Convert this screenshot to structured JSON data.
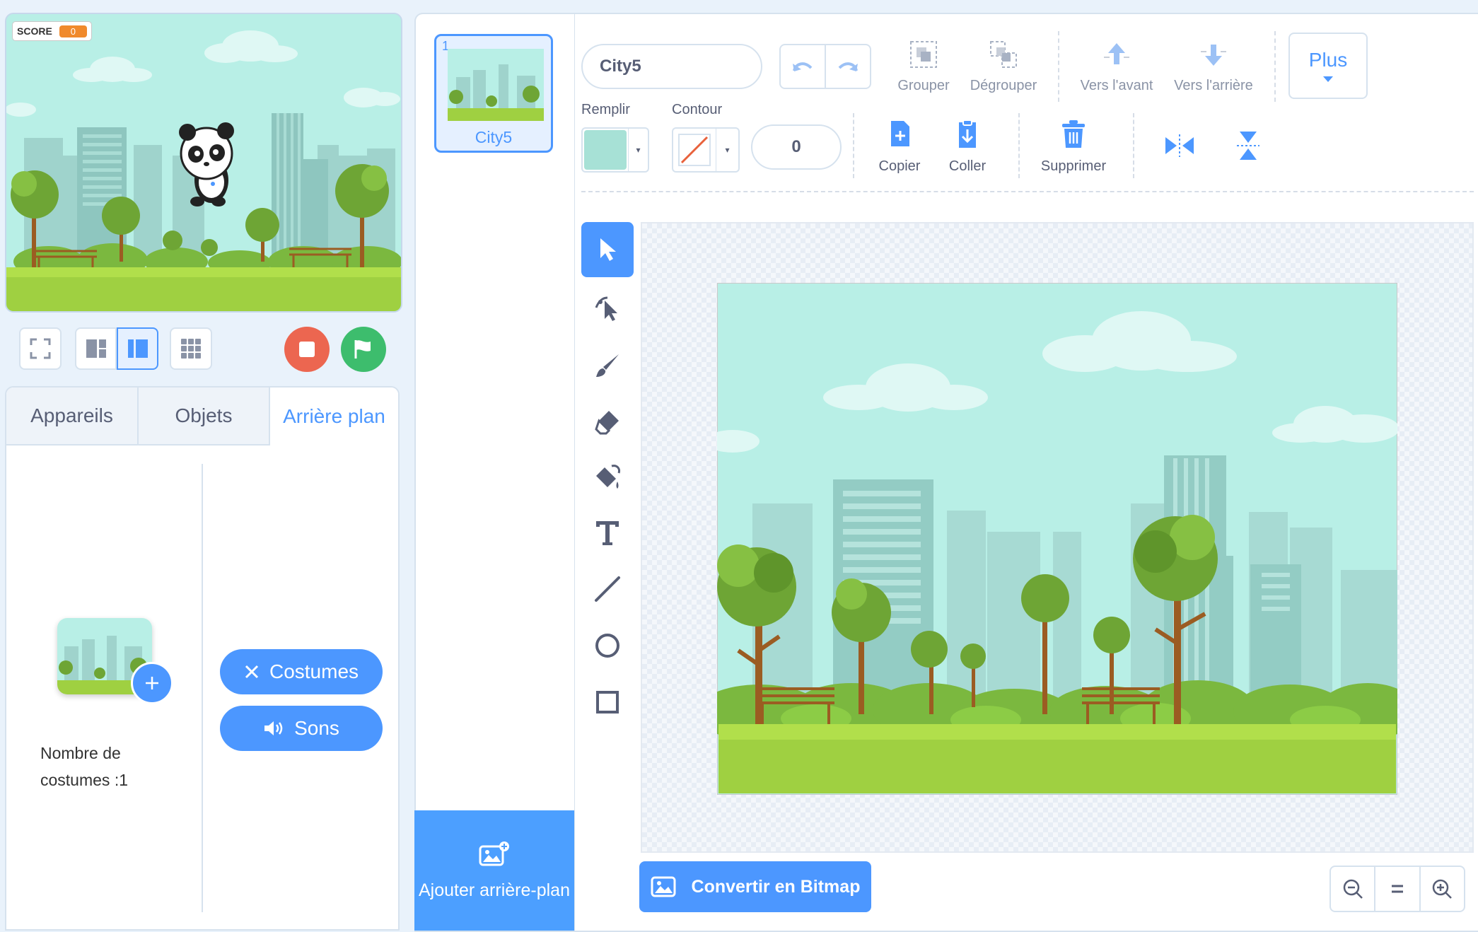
{
  "stage": {
    "score_label": "SCORE",
    "score_value": "0"
  },
  "controls": {
    "fullscreen": "fullscreen-icon",
    "small_stage": "small-stage-icon",
    "large_stage": "large-stage-icon",
    "grid": "grid-icon",
    "stop_color": "#ec6650",
    "go_color": "#3dbd6d"
  },
  "tabs": [
    {
      "label": "Appareils"
    },
    {
      "label": "Objets"
    },
    {
      "label": "Arrière plan",
      "active": true
    }
  ],
  "backdrop_panel": {
    "costume_count_label": "Nombre de costumes :1",
    "costumes_button": "Costumes",
    "sounds_button": "Sons"
  },
  "costume_list": {
    "items": [
      {
        "index": "1",
        "name": "City5",
        "selected": true
      }
    ],
    "add_button": "Ajouter arrière-plan"
  },
  "editor": {
    "costume_name": "City5",
    "fill_label": "Remplir",
    "fill_color": "#a7e1d6",
    "outline_label": "Contour",
    "outline_color": "none",
    "outline_width": "0",
    "actions": {
      "group": "Grouper",
      "ungroup": "Dégrouper",
      "forward": "Vers l'avant",
      "backward": "Vers l'arrière",
      "more": "Plus",
      "copy": "Copier",
      "paste": "Coller",
      "delete": "Supprimer"
    },
    "convert_button": "Convertir en Bitmap",
    "accent_color": "#4c97ff"
  }
}
